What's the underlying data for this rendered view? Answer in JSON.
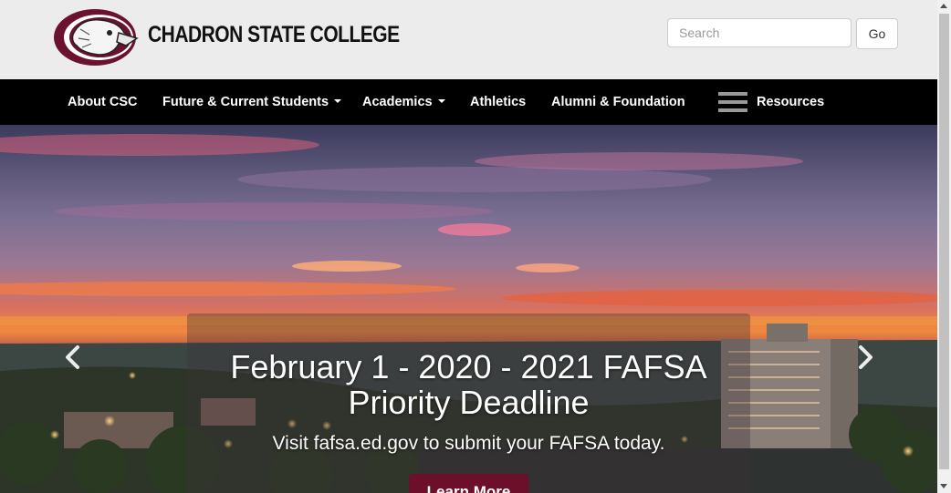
{
  "header": {
    "brand": "CHADRON STATE COLLEGE",
    "logo_icon": "eagle-logo-icon",
    "search_placeholder": "Search",
    "go_label": "Go"
  },
  "nav": {
    "items": [
      {
        "label": "About CSC",
        "dropdown": false
      },
      {
        "label": "Future & Current Students",
        "dropdown": true
      },
      {
        "label": "Academics",
        "dropdown": true
      },
      {
        "label": "Athletics",
        "dropdown": false
      },
      {
        "label": "Alumni & Foundation",
        "dropdown": false
      }
    ],
    "resources_label": "Resources",
    "resources_icon": "hamburger-menu-icon"
  },
  "hero": {
    "title": "February 1 - 2020 - 2021 FAFSA Priority Deadline",
    "subtitle": "Visit fafsa.ed.gov to submit your FAFSA today.",
    "button_label": "Learn More",
    "prev_icon": "chevron-left-icon",
    "next_icon": "chevron-right-icon"
  },
  "colors": {
    "nav_bg": "#000000",
    "topbar_bg": "#ececec",
    "brand_maroon": "#6b0f2b"
  }
}
